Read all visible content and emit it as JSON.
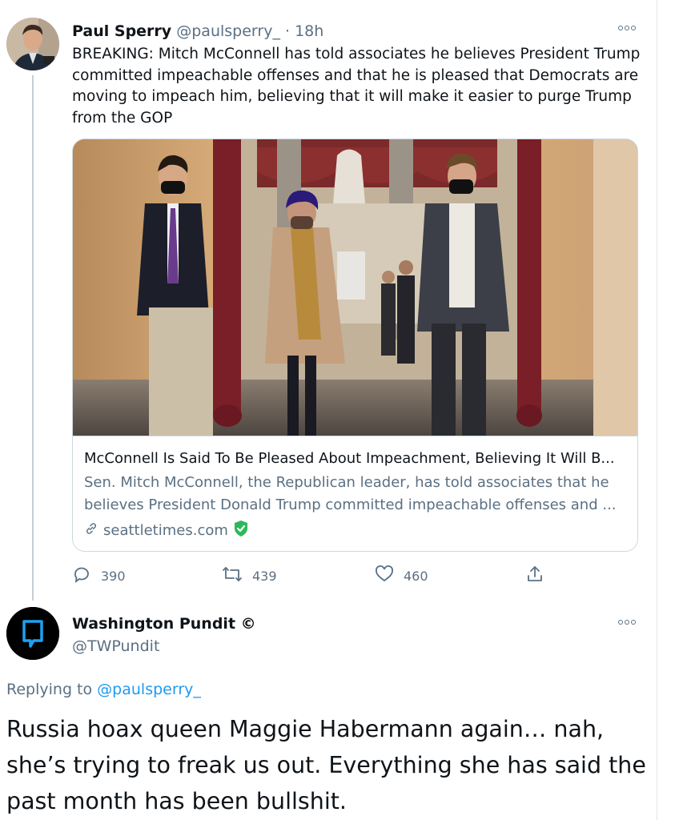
{
  "tweet1": {
    "display_name": "Paul Sperry",
    "handle": "@paulsperry_",
    "time": "· 18h",
    "text": "BREAKING: Mitch McConnell has told associates he believes President Trump committed impeachable offenses and that he is pleased that Democrats are moving to impeach him, believing that it will make it easier to purge Trump from the GOP",
    "card": {
      "title": "McConnell Is Said To Be Pleased About Impeachment, Believing It Will B...",
      "description": "Sen. Mitch McConnell, the Republican leader, has told associates that he believes President Donald Trump committed impeachable offenses and ...",
      "domain": "seattletimes.com"
    },
    "actions": {
      "replies": "390",
      "retweets": "439",
      "likes": "460"
    }
  },
  "tweet2": {
    "display_name": "Washington Pundit ©",
    "handle": "@TWPundit",
    "replying_prefix": "Replying to",
    "replying_to": "@paulsperry_",
    "text": "Russia hoax queen Maggie Habermann again… nah, she’s trying to freak us out. Everything she has said the past month has been bullshit."
  },
  "icons": {
    "more": "more-options-icon",
    "reply": "reply-icon",
    "retweet": "retweet-icon",
    "like": "heart-icon",
    "share": "share-icon",
    "link": "link-icon",
    "verified_shield": "verified-shield-icon"
  },
  "colors": {
    "link": "#1d9bf0",
    "muted": "#5b7083",
    "shield": "#2eb85c"
  }
}
